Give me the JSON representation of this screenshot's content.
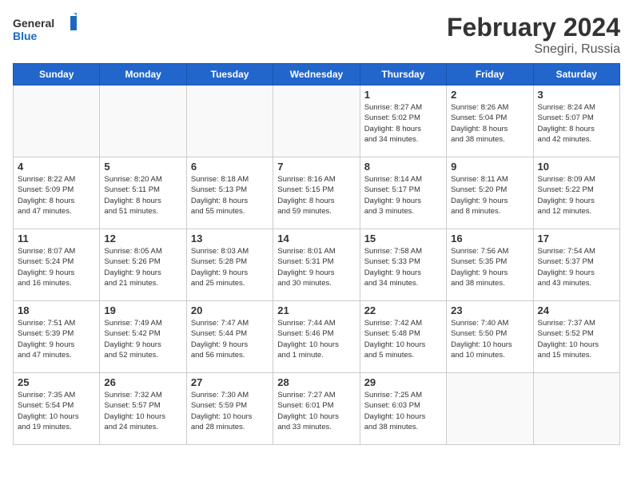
{
  "header": {
    "logo_general": "General",
    "logo_blue": "Blue",
    "main_title": "February 2024",
    "sub_title": "Snegiri, Russia"
  },
  "weekdays": [
    "Sunday",
    "Monday",
    "Tuesday",
    "Wednesday",
    "Thursday",
    "Friday",
    "Saturday"
  ],
  "weeks": [
    [
      {
        "day": "",
        "info": ""
      },
      {
        "day": "",
        "info": ""
      },
      {
        "day": "",
        "info": ""
      },
      {
        "day": "",
        "info": ""
      },
      {
        "day": "1",
        "info": "Sunrise: 8:27 AM\nSunset: 5:02 PM\nDaylight: 8 hours\nand 34 minutes."
      },
      {
        "day": "2",
        "info": "Sunrise: 8:26 AM\nSunset: 5:04 PM\nDaylight: 8 hours\nand 38 minutes."
      },
      {
        "day": "3",
        "info": "Sunrise: 8:24 AM\nSunset: 5:07 PM\nDaylight: 8 hours\nand 42 minutes."
      }
    ],
    [
      {
        "day": "4",
        "info": "Sunrise: 8:22 AM\nSunset: 5:09 PM\nDaylight: 8 hours\nand 47 minutes."
      },
      {
        "day": "5",
        "info": "Sunrise: 8:20 AM\nSunset: 5:11 PM\nDaylight: 8 hours\nand 51 minutes."
      },
      {
        "day": "6",
        "info": "Sunrise: 8:18 AM\nSunset: 5:13 PM\nDaylight: 8 hours\nand 55 minutes."
      },
      {
        "day": "7",
        "info": "Sunrise: 8:16 AM\nSunset: 5:15 PM\nDaylight: 8 hours\nand 59 minutes."
      },
      {
        "day": "8",
        "info": "Sunrise: 8:14 AM\nSunset: 5:17 PM\nDaylight: 9 hours\nand 3 minutes."
      },
      {
        "day": "9",
        "info": "Sunrise: 8:11 AM\nSunset: 5:20 PM\nDaylight: 9 hours\nand 8 minutes."
      },
      {
        "day": "10",
        "info": "Sunrise: 8:09 AM\nSunset: 5:22 PM\nDaylight: 9 hours\nand 12 minutes."
      }
    ],
    [
      {
        "day": "11",
        "info": "Sunrise: 8:07 AM\nSunset: 5:24 PM\nDaylight: 9 hours\nand 16 minutes."
      },
      {
        "day": "12",
        "info": "Sunrise: 8:05 AM\nSunset: 5:26 PM\nDaylight: 9 hours\nand 21 minutes."
      },
      {
        "day": "13",
        "info": "Sunrise: 8:03 AM\nSunset: 5:28 PM\nDaylight: 9 hours\nand 25 minutes."
      },
      {
        "day": "14",
        "info": "Sunrise: 8:01 AM\nSunset: 5:31 PM\nDaylight: 9 hours\nand 30 minutes."
      },
      {
        "day": "15",
        "info": "Sunrise: 7:58 AM\nSunset: 5:33 PM\nDaylight: 9 hours\nand 34 minutes."
      },
      {
        "day": "16",
        "info": "Sunrise: 7:56 AM\nSunset: 5:35 PM\nDaylight: 9 hours\nand 38 minutes."
      },
      {
        "day": "17",
        "info": "Sunrise: 7:54 AM\nSunset: 5:37 PM\nDaylight: 9 hours\nand 43 minutes."
      }
    ],
    [
      {
        "day": "18",
        "info": "Sunrise: 7:51 AM\nSunset: 5:39 PM\nDaylight: 9 hours\nand 47 minutes."
      },
      {
        "day": "19",
        "info": "Sunrise: 7:49 AM\nSunset: 5:42 PM\nDaylight: 9 hours\nand 52 minutes."
      },
      {
        "day": "20",
        "info": "Sunrise: 7:47 AM\nSunset: 5:44 PM\nDaylight: 9 hours\nand 56 minutes."
      },
      {
        "day": "21",
        "info": "Sunrise: 7:44 AM\nSunset: 5:46 PM\nDaylight: 10 hours\nand 1 minute."
      },
      {
        "day": "22",
        "info": "Sunrise: 7:42 AM\nSunset: 5:48 PM\nDaylight: 10 hours\nand 5 minutes."
      },
      {
        "day": "23",
        "info": "Sunrise: 7:40 AM\nSunset: 5:50 PM\nDaylight: 10 hours\nand 10 minutes."
      },
      {
        "day": "24",
        "info": "Sunrise: 7:37 AM\nSunset: 5:52 PM\nDaylight: 10 hours\nand 15 minutes."
      }
    ],
    [
      {
        "day": "25",
        "info": "Sunrise: 7:35 AM\nSunset: 5:54 PM\nDaylight: 10 hours\nand 19 minutes."
      },
      {
        "day": "26",
        "info": "Sunrise: 7:32 AM\nSunset: 5:57 PM\nDaylight: 10 hours\nand 24 minutes."
      },
      {
        "day": "27",
        "info": "Sunrise: 7:30 AM\nSunset: 5:59 PM\nDaylight: 10 hours\nand 28 minutes."
      },
      {
        "day": "28",
        "info": "Sunrise: 7:27 AM\nSunset: 6:01 PM\nDaylight: 10 hours\nand 33 minutes."
      },
      {
        "day": "29",
        "info": "Sunrise: 7:25 AM\nSunset: 6:03 PM\nDaylight: 10 hours\nand 38 minutes."
      },
      {
        "day": "",
        "info": ""
      },
      {
        "day": "",
        "info": ""
      }
    ]
  ]
}
